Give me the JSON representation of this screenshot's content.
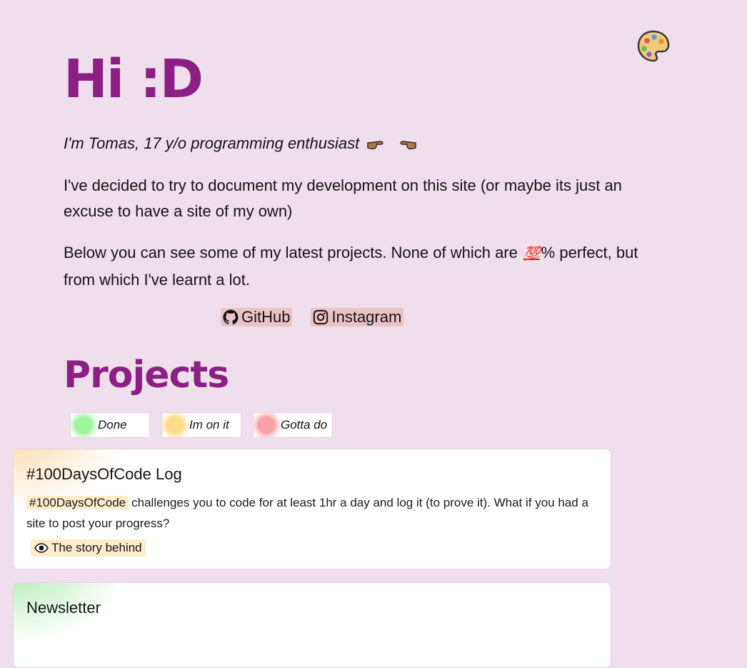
{
  "header": {
    "title": "Hi :D",
    "palette_icon": "palette-icon"
  },
  "intro": {
    "tagline": "I'm Tomas, 17 y/o programming enthusiast",
    "paragraph1": "I've decided to try to document my development on this site (or maybe its just an excuse to have a site of my own)",
    "paragraph2_before": "Below you can see some of my latest projects. None of which are",
    "hundred_emoji": "💯",
    "paragraph2_after": "% perfect, but from which I've learnt a lot."
  },
  "links": [
    {
      "label": "GitHub",
      "icon": "github-icon"
    },
    {
      "label": "Instagram",
      "icon": "instagram-icon"
    }
  ],
  "projects": {
    "heading": "Projects",
    "filters": [
      {
        "label": "Done",
        "color": "#9ef59e"
      },
      {
        "label": "Im on it",
        "color": "#fcdd8a"
      },
      {
        "label": "Gotta do",
        "color": "#f7a2a8"
      }
    ],
    "cards": [
      {
        "title": "#100DaysOfCode Log",
        "tag": "#100DaysOfCode",
        "description": "challenges you to code for at least 1hr a day and log it (to prove it). What if you had a site to post your progress?",
        "story_label": "The story behind"
      },
      {
        "title": "Newsletter"
      }
    ]
  }
}
